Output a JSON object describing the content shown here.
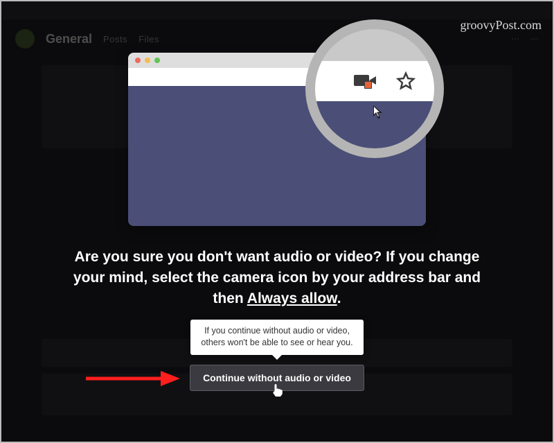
{
  "watermark": "groovyPost.com",
  "background": {
    "channel_title": "General",
    "tab1": "Posts",
    "tab2": "Files"
  },
  "modal": {
    "headline_pre": "Are you sure you don't want audio or video? If you change your mind, select the camera icon by your address bar and then ",
    "headline_underlined": "Always allow",
    "headline_post": ".",
    "tooltip": "If you continue without audio or video, others won't be able to see or hear you.",
    "continue_label": "Continue without audio or video"
  }
}
